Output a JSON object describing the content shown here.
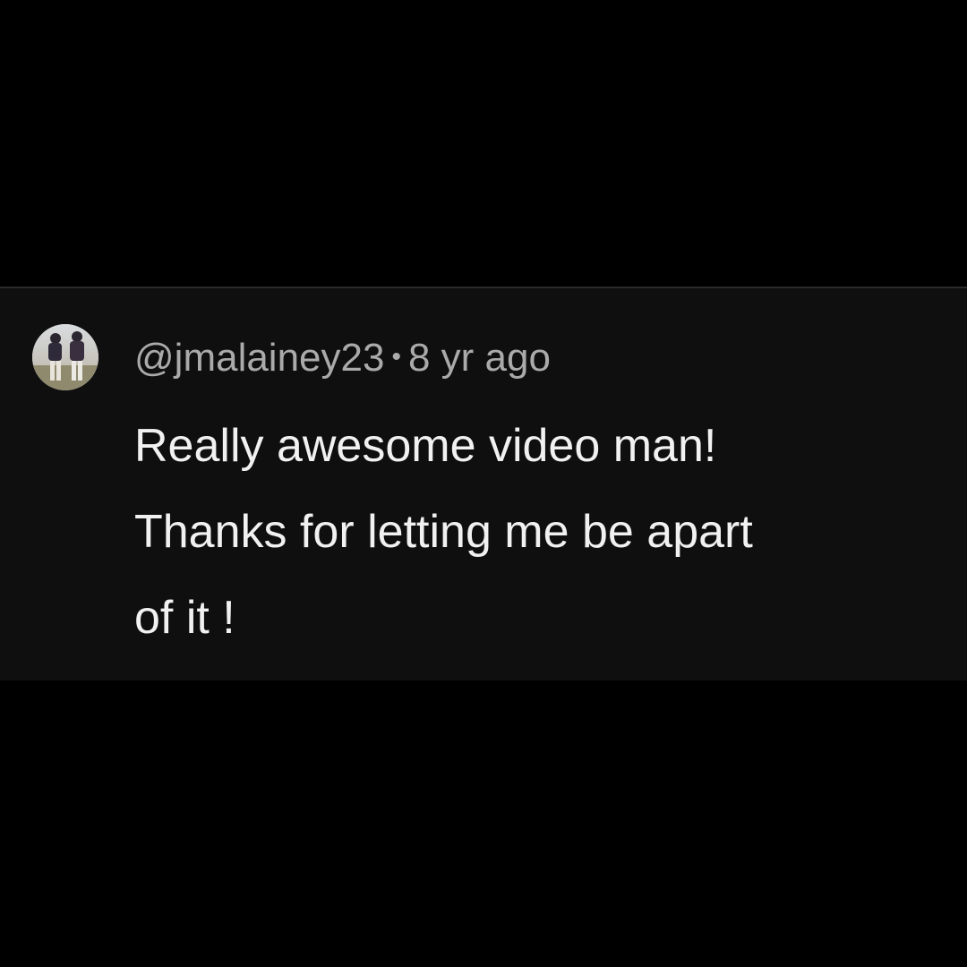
{
  "comment": {
    "username": "@jmalainey23",
    "separator": "•",
    "timestamp": "8 yr ago",
    "text_lines": [
      "Really awesome video man!",
      "Thanks for letting me be apart",
      "of it !"
    ],
    "avatar": "user-avatar-photo"
  },
  "colors": {
    "page_background": "#000000",
    "card_background": "#0f0f0f",
    "meta_text": "#aaaaaa",
    "body_text": "#f1f1f1"
  }
}
